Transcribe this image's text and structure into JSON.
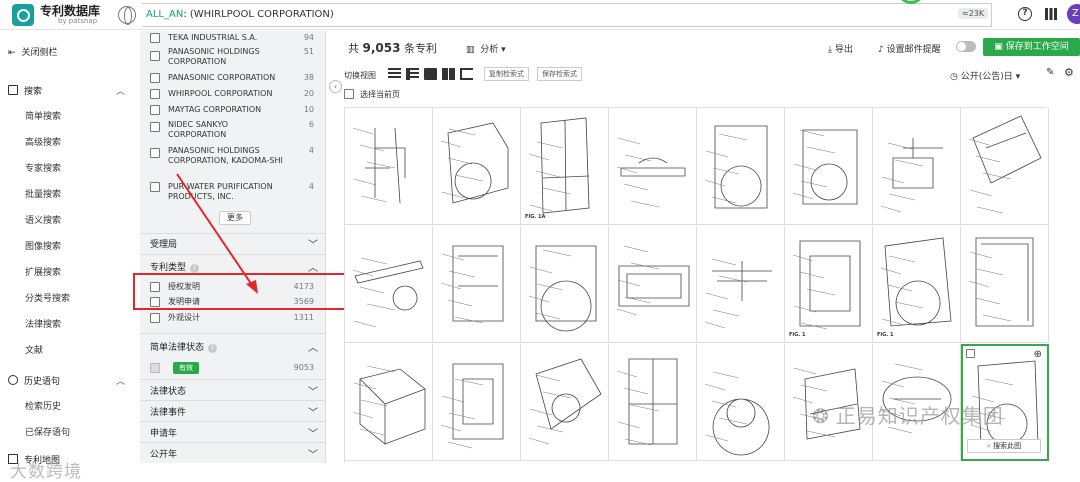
{
  "header": {
    "logo_title": "专利数据库",
    "logo_sub": "by patsnap",
    "query_prefix": "ALL_AN",
    "query_rest": ": (WHIRLPOOL CORPORATION)",
    "result_badge": "≈23K",
    "help_glyph": "?",
    "avatar_letter": "Z"
  },
  "sidebar": {
    "close_label": "关闭侧栏",
    "search_section": "搜索",
    "items": [
      "简单搜索",
      "高级搜索",
      "专家搜索",
      "批量搜索",
      "语义搜索",
      "图像搜索",
      "扩展搜索",
      "分类号搜索",
      "法律搜索",
      "文献"
    ],
    "history_section": "历史语句",
    "history_items": [
      "检索历史",
      "已保存语句"
    ],
    "bottom_section": "专利地图"
  },
  "filter": {
    "assignees": [
      {
        "name": "TEKA INDUSTRIAL S.A.",
        "count": "94"
      },
      {
        "name": "PANASONIC HOLDINGS CORPORATION",
        "count": "51"
      },
      {
        "name": "PANASONIC CORPORATION",
        "count": "38"
      },
      {
        "name": "WHIRPOOL CORPORATION",
        "count": "20"
      },
      {
        "name": "MAYTAG CORPORATION",
        "count": "10"
      },
      {
        "name": "NIDEC SANKYO CORPORATION",
        "count": "6"
      },
      {
        "name": "PANASONIC HOLDINGS CORPORATION, KADOMA-SHI",
        "count": "4"
      },
      {
        "name": "PUR WATER PURIFICATION PRODUCTS, INC.",
        "count": "4"
      }
    ],
    "more_label": "更多",
    "office_label": "受理局",
    "type_label": "专利类型",
    "types": [
      {
        "name": "授权发明",
        "count": "4173"
      },
      {
        "name": "发明申请",
        "count": "3569"
      },
      {
        "name": "外观设计",
        "count": "1311"
      }
    ],
    "legal_simple_label": "简单法律状态",
    "valid_label": "有效",
    "valid_count": "9053",
    "sections": [
      "法律状态",
      "法律事件",
      "申请年",
      "公开年"
    ]
  },
  "main": {
    "total_prefix": "共",
    "total_count": "9,053",
    "total_suffix": "条专利",
    "analysis_label": "分析",
    "export_label": "导出",
    "alert_label": "设置邮件提醒",
    "save_label": "保存到工作空间",
    "view_label": "切换视图",
    "copy_query_label": "复制检索式",
    "save_query_label": "保存检索式",
    "sort_label": "公开(公告)日",
    "select_page_label": "选择当前页",
    "search_this_label": "搜索此图",
    "fig_labels": [
      "FIG. 1A",
      "FIG. 1",
      "FIG. 1"
    ]
  },
  "watermarks": {
    "left": "大数跨境",
    "right": "正易知识产权集团"
  },
  "colors": {
    "accent_green": "#2aa84a",
    "highlight_red": "#e5262a",
    "logo_teal": "#16a0a0"
  }
}
